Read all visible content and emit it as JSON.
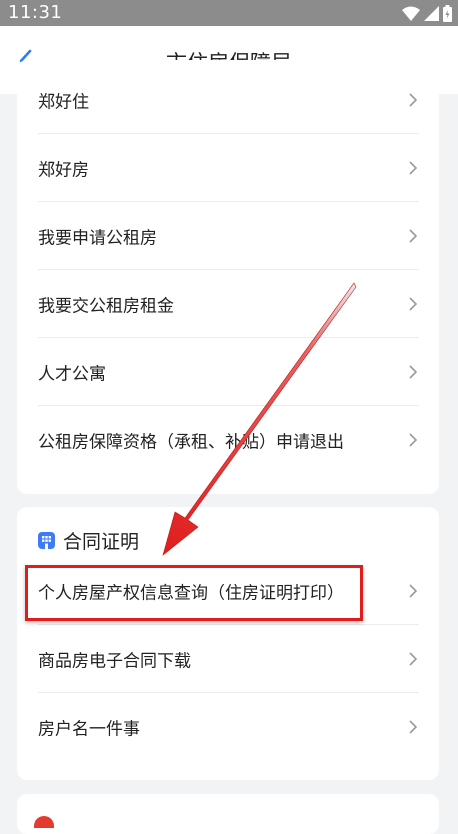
{
  "status_bar": {
    "time": "11:31"
  },
  "header": {
    "title": "市住房保障局"
  },
  "card1": {
    "items": [
      {
        "label": "郑好住"
      },
      {
        "label": "郑好房"
      },
      {
        "label": "我要申请公租房"
      },
      {
        "label": "我要交公租房租金"
      },
      {
        "label": "人才公寓"
      },
      {
        "label": "公租房保障资格（承租、补贴）申请退出"
      }
    ]
  },
  "card2": {
    "section_title": "合同证明",
    "items": [
      {
        "label": "个人房屋产权信息查询（住房证明打印）"
      },
      {
        "label": "商品房电子合同下载"
      },
      {
        "label": "房户名一件事"
      }
    ]
  },
  "colors": {
    "highlight": "#e01d1d",
    "section_icon": "#3d7bf7",
    "back_icon": "#2f7bf6"
  },
  "icons": [
    "wifi-icon",
    "signal-icon",
    "battery-icon",
    "back-arrow-icon",
    "chevron-right-icon",
    "building-icon"
  ]
}
